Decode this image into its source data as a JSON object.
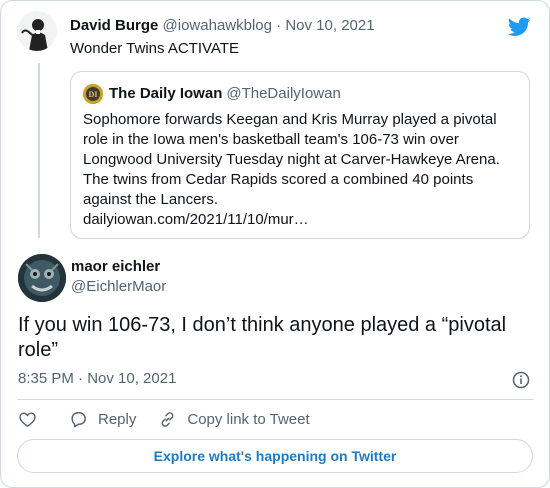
{
  "parent_tweet": {
    "author_name": "David Burge",
    "author_handle": "@iowahawkblog",
    "separator": "·",
    "date": "Nov 10, 2021",
    "text": "Wonder Twins ACTIVATE",
    "quoted_tweet": {
      "avatar_text": "DI",
      "author_name": "The Daily Iowan",
      "author_handle": "@TheDailyIowan",
      "text_lines": [
        "Sophomore forwards Keegan and Kris Murray played a pivotal",
        "role in the Iowa men's basketball team's 106-73 win over",
        "Longwood University Tuesday night at Carver-Hawkeye Arena.",
        "The twins from Cedar Rapids scored a combined 40 points",
        "against the Lancers.",
        "dailyiowan.com/2021/11/10/mur…"
      ]
    }
  },
  "main_tweet": {
    "author_name": "maor eichler",
    "author_handle": "@EichlerMaor",
    "text_lines": [
      "If you win 106-73, I don’t think anyone played a “pivotal",
      "role”"
    ],
    "timestamp": "8:35 PM · Nov 10, 2021"
  },
  "actions": {
    "like_icon": "heart-icon",
    "reply_label": "Reply",
    "reply_icon": "reply-icon",
    "copy_link_label": "Copy link to Tweet",
    "copy_link_icon": "link-icon"
  },
  "explore_button": "Explore what's happening on Twitter",
  "colors": {
    "twitter_blue": "#1d9bf0",
    "link_blue": "#1d7bc4",
    "muted_text": "#536471",
    "border": "#cfd9de"
  }
}
